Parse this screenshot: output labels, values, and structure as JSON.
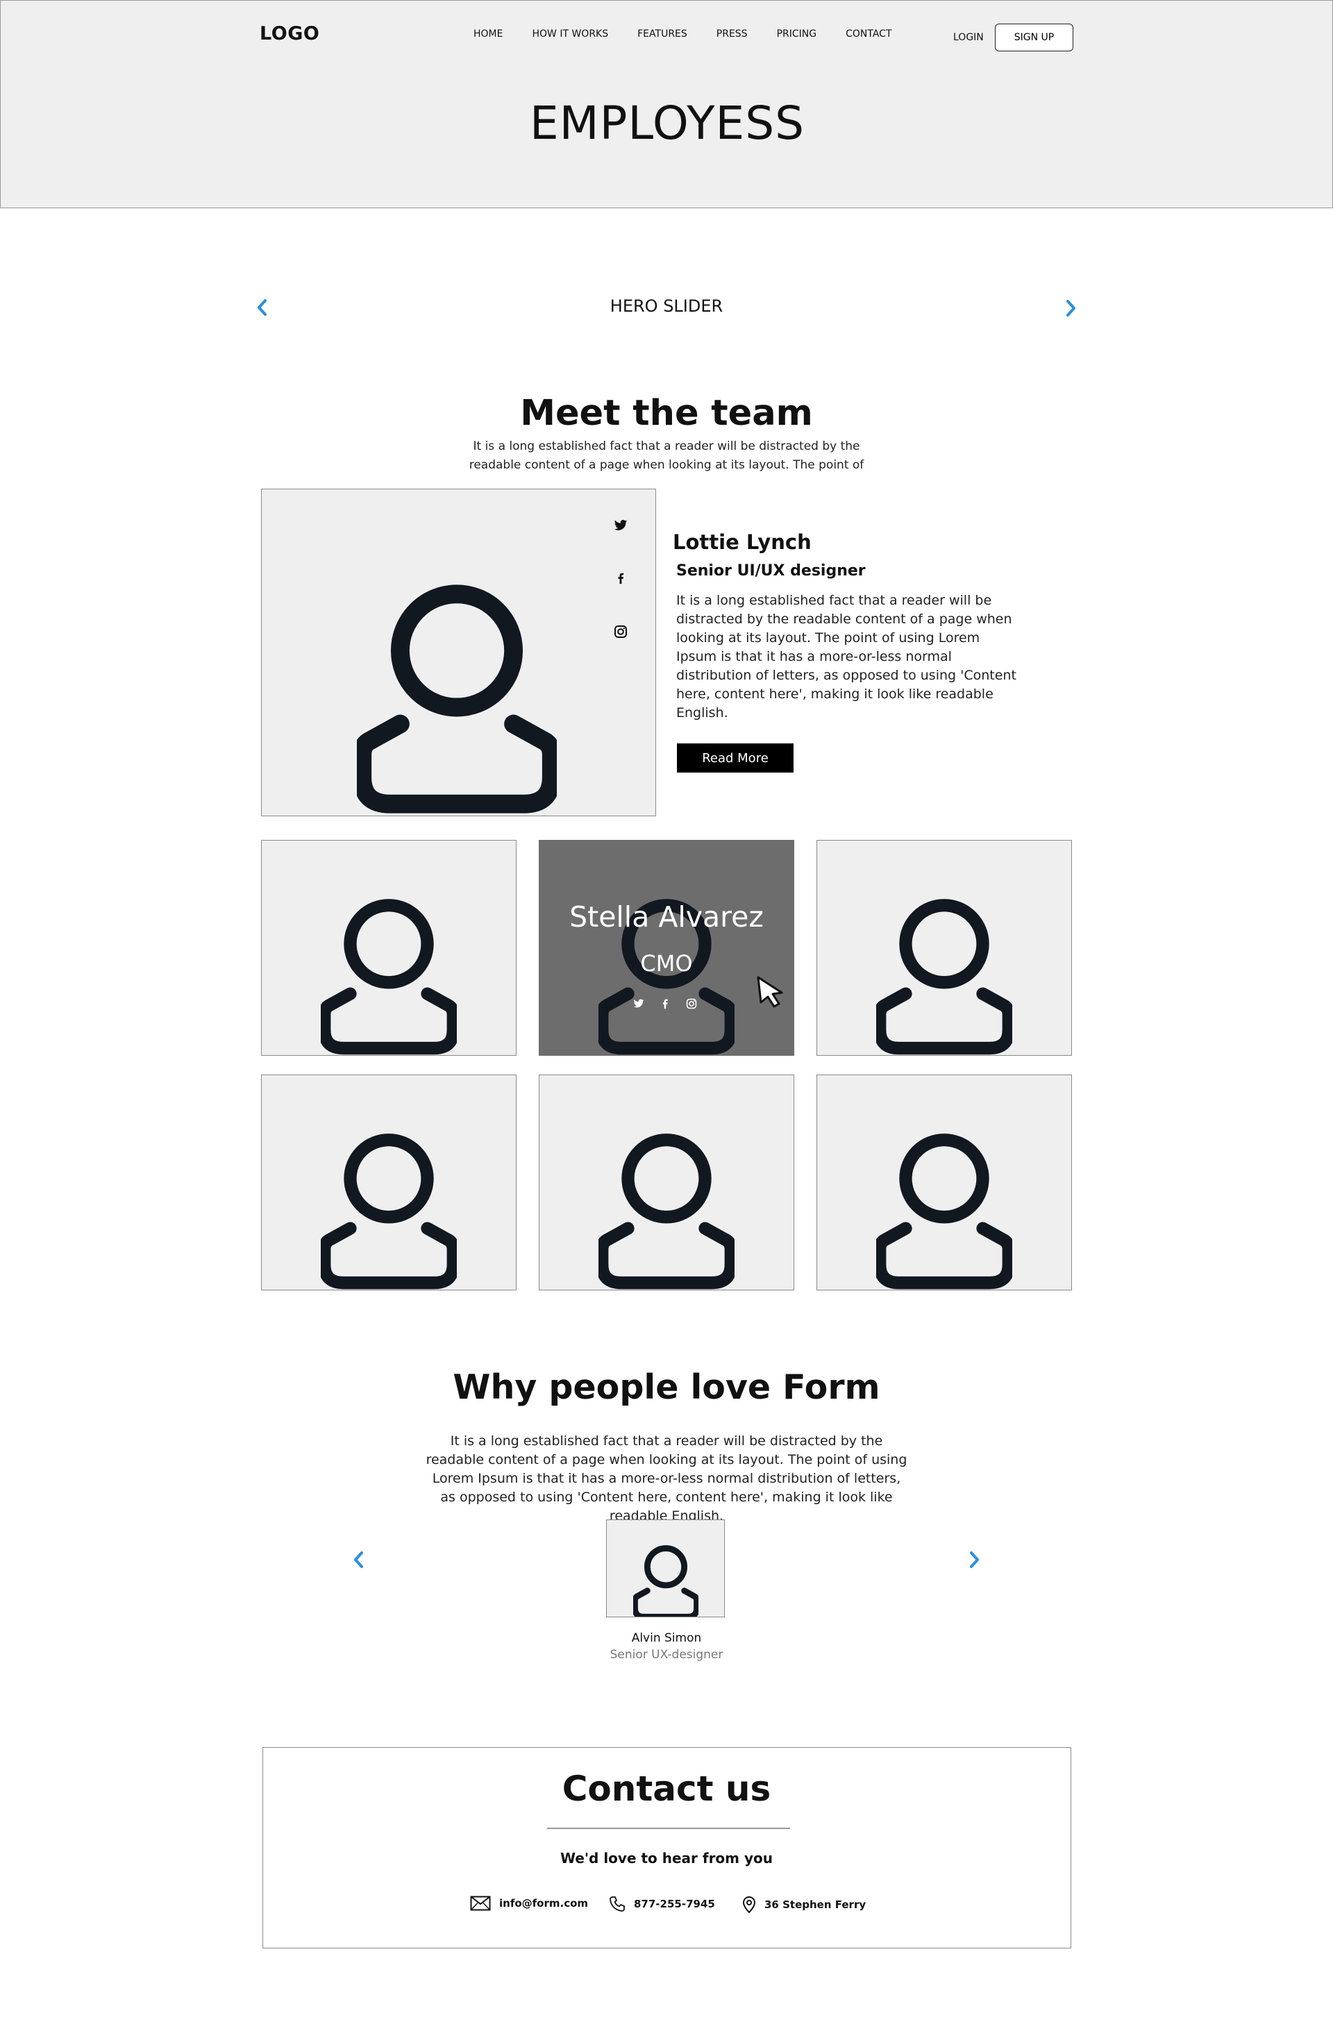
{
  "header": {
    "logo": "LOGO",
    "nav": [
      "HOME",
      "HOW IT WORKS",
      "FEATURES",
      "PRESS",
      "PRICING",
      "CONTACT"
    ],
    "login": "LOGIN",
    "signup": "SIGN UP",
    "page_title": "EMPLOYESS"
  },
  "hero": {
    "label": "HERO SLIDER",
    "prev_icon": "chevron-left-icon",
    "next_icon": "chevron-right-icon",
    "accent_color": "#2a8fe0"
  },
  "team": {
    "title": "Meet the team",
    "intro": "It is a long established fact that a reader will be distracted by the readable content of a page when looking at its layout. The point of",
    "featured": {
      "name": "Lottie Lynch",
      "role": "Senior UI/UX designer",
      "bio": "It is a long established fact that a reader will be distracted by the readable content of a page when looking at its layout. The point of using Lorem Ipsum is that it has a more-or-less normal distribution of letters, as opposed to using 'Content here, content here', making it look like readable English.",
      "button": "Read More",
      "social_icons": [
        "twitter-icon",
        "facebook-icon",
        "instagram-icon"
      ]
    },
    "hover_member": {
      "name": "Stella Alvarez",
      "role": "CMO",
      "social_icons": [
        "twitter-icon",
        "facebook-icon",
        "instagram-icon"
      ]
    }
  },
  "why": {
    "title": "Why people love Form",
    "text": "It is a long established fact that a reader will be distracted by the readable content of a page when looking at its layout. The point of using Lorem Ipsum is that it has a more-or-less normal distribution of letters, as opposed to using 'Content here, content here', making it look like readable English.",
    "testimonial": {
      "name": "Alvin Simon",
      "role": "Senior UX-designer"
    }
  },
  "contact": {
    "title": "Contact us",
    "subtitle": "We'd love to hear from you",
    "email": "info@form.com",
    "phone": "877-255-7945",
    "address": "36 Stephen Ferry"
  },
  "colors": {
    "header_bg": "#efefef",
    "card_bg": "#efefef",
    "hover_overlay": "#6d6d6d",
    "avatar_stroke": "#111820"
  }
}
